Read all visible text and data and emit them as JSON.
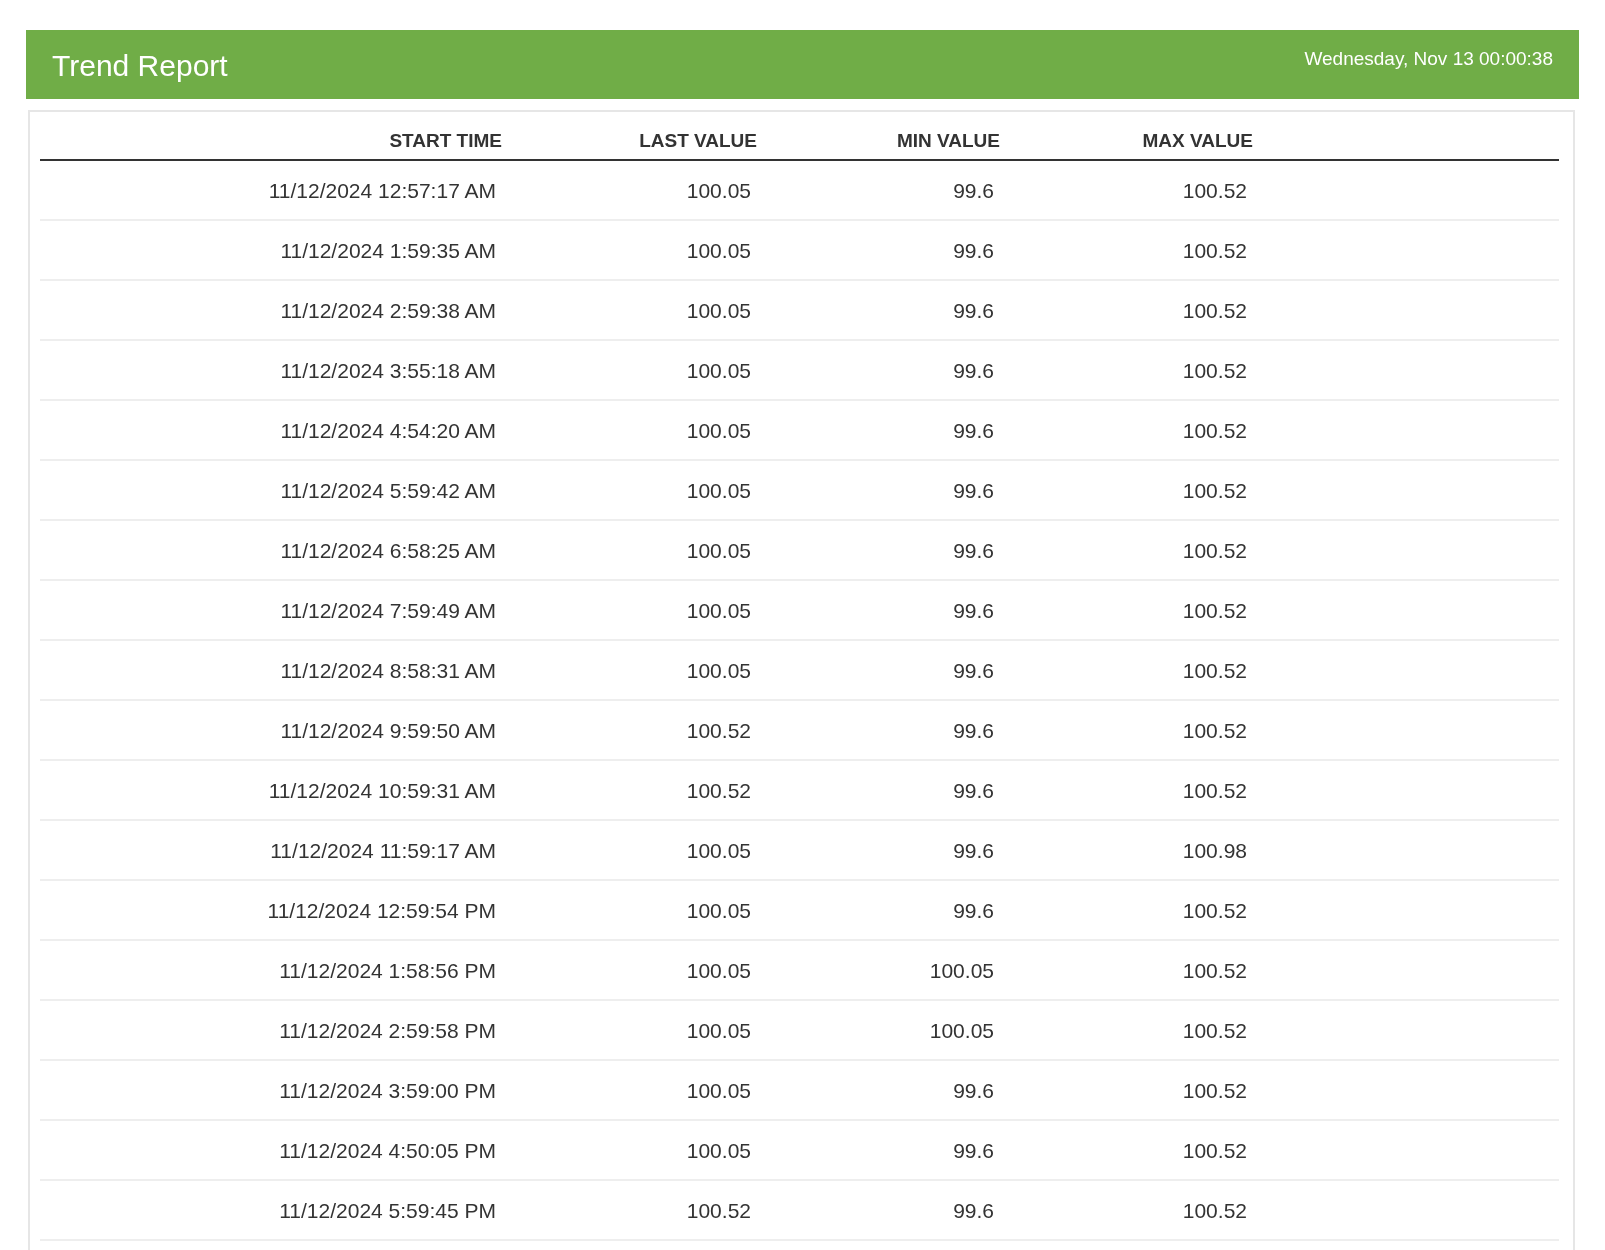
{
  "header": {
    "title": "Trend Report",
    "datetime": "Wednesday, Nov 13 00:00:38"
  },
  "table": {
    "columns": [
      "START TIME",
      "LAST VALUE",
      "MIN VALUE",
      "MAX VALUE"
    ],
    "rows": [
      [
        "11/12/2024 12:57:17 AM",
        "100.05",
        "99.6",
        "100.52"
      ],
      [
        "11/12/2024 1:59:35 AM",
        "100.05",
        "99.6",
        "100.52"
      ],
      [
        "11/12/2024 2:59:38 AM",
        "100.05",
        "99.6",
        "100.52"
      ],
      [
        "11/12/2024 3:55:18 AM",
        "100.05",
        "99.6",
        "100.52"
      ],
      [
        "11/12/2024 4:54:20 AM",
        "100.05",
        "99.6",
        "100.52"
      ],
      [
        "11/12/2024 5:59:42 AM",
        "100.05",
        "99.6",
        "100.52"
      ],
      [
        "11/12/2024 6:58:25 AM",
        "100.05",
        "99.6",
        "100.52"
      ],
      [
        "11/12/2024 7:59:49 AM",
        "100.05",
        "99.6",
        "100.52"
      ],
      [
        "11/12/2024 8:58:31 AM",
        "100.05",
        "99.6",
        "100.52"
      ],
      [
        "11/12/2024 9:59:50 AM",
        "100.52",
        "99.6",
        "100.52"
      ],
      [
        "11/12/2024 10:59:31 AM",
        "100.52",
        "99.6",
        "100.52"
      ],
      [
        "11/12/2024 11:59:17 AM",
        "100.05",
        "99.6",
        "100.98"
      ],
      [
        "11/12/2024 12:59:54 PM",
        "100.05",
        "99.6",
        "100.52"
      ],
      [
        "11/12/2024 1:58:56 PM",
        "100.05",
        "100.05",
        "100.52"
      ],
      [
        "11/12/2024 2:59:58 PM",
        "100.05",
        "100.05",
        "100.52"
      ],
      [
        "11/12/2024 3:59:00 PM",
        "100.05",
        "99.6",
        "100.52"
      ],
      [
        "11/12/2024 4:50:05 PM",
        "100.05",
        "99.6",
        "100.52"
      ],
      [
        "11/12/2024 5:59:45 PM",
        "100.52",
        "99.6",
        "100.52"
      ]
    ]
  }
}
